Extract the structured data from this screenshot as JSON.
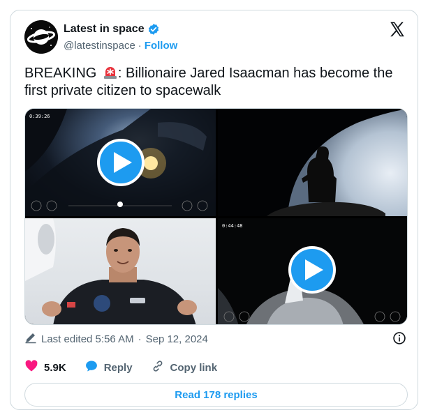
{
  "account": {
    "name": "Latest in space",
    "handle": "@latestinspace",
    "separator": "·",
    "follow_label": "Follow"
  },
  "tweet": {
    "text_before": "BREAKING ",
    "text_after": ": Billionaire Jared Isaacman has become the first private citizen to spacewalk"
  },
  "media": {
    "tile1_timer": "0:39:26",
    "tile4_timer": "0:44:48"
  },
  "meta": {
    "edited_label": "Last edited 5:56 AM",
    "separator": "·",
    "date": "Sep 12, 2024"
  },
  "actions": {
    "likes_count": "5.9K",
    "reply_label": "Reply",
    "copy_label": "Copy link"
  },
  "replies_button": "Read 178 replies",
  "colors": {
    "accent": "#1d9bf0",
    "like": "#f91880",
    "text_secondary": "#536471"
  }
}
